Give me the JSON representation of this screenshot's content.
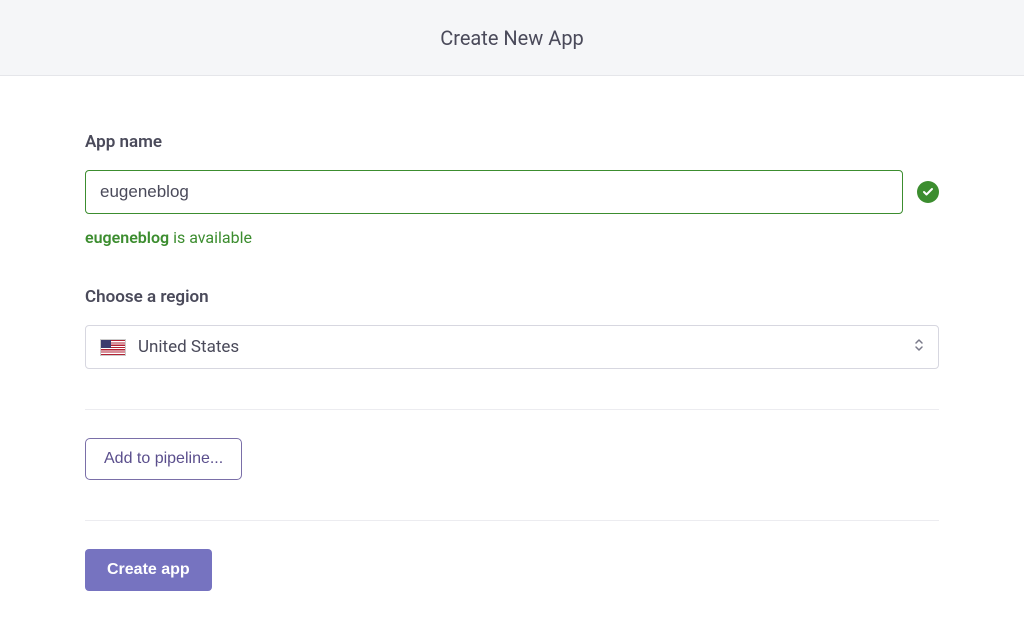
{
  "header": {
    "title": "Create New App"
  },
  "form": {
    "appName": {
      "label": "App name",
      "value": "eugeneblog",
      "availability": {
        "name": "eugeneblog",
        "status": " is available"
      }
    },
    "region": {
      "label": "Choose a region",
      "selected": "United States"
    },
    "pipelineButton": "Add to pipeline...",
    "createButton": "Create app"
  }
}
